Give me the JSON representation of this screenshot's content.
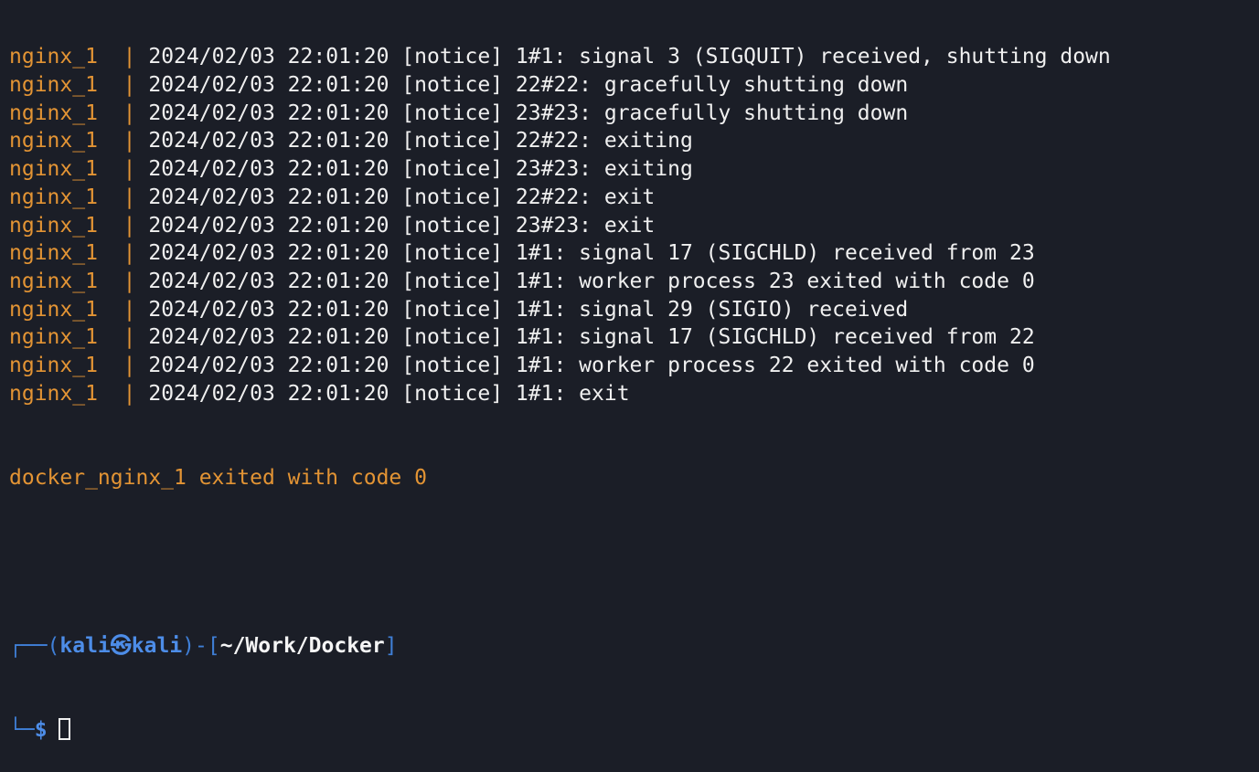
{
  "log": {
    "lines": [
      {
        "service": "nginx_1",
        "separator": "|",
        "message": "2024/02/03 22:01:20 [notice] 1#1: signal 3 (SIGQUIT) received, shutting down"
      },
      {
        "service": "nginx_1",
        "separator": "|",
        "message": "2024/02/03 22:01:20 [notice] 22#22: gracefully shutting down"
      },
      {
        "service": "nginx_1",
        "separator": "|",
        "message": "2024/02/03 22:01:20 [notice] 23#23: gracefully shutting down"
      },
      {
        "service": "nginx_1",
        "separator": "|",
        "message": "2024/02/03 22:01:20 [notice] 22#22: exiting"
      },
      {
        "service": "nginx_1",
        "separator": "|",
        "message": "2024/02/03 22:01:20 [notice] 23#23: exiting"
      },
      {
        "service": "nginx_1",
        "separator": "|",
        "message": "2024/02/03 22:01:20 [notice] 22#22: exit"
      },
      {
        "service": "nginx_1",
        "separator": "|",
        "message": "2024/02/03 22:01:20 [notice] 23#23: exit"
      },
      {
        "service": "nginx_1",
        "separator": "|",
        "message": "2024/02/03 22:01:20 [notice] 1#1: signal 17 (SIGCHLD) received from 23"
      },
      {
        "service": "nginx_1",
        "separator": "|",
        "message": "2024/02/03 22:01:20 [notice] 1#1: worker process 23 exited with code 0"
      },
      {
        "service": "nginx_1",
        "separator": "|",
        "message": "2024/02/03 22:01:20 [notice] 1#1: signal 29 (SIGIO) received"
      },
      {
        "service": "nginx_1",
        "separator": "|",
        "message": "2024/02/03 22:01:20 [notice] 1#1: signal 17 (SIGCHLD) received from 22"
      },
      {
        "service": "nginx_1",
        "separator": "|",
        "message": "2024/02/03 22:01:20 [notice] 1#1: worker process 22 exited with code 0"
      },
      {
        "service": "nginx_1",
        "separator": "|",
        "message": "2024/02/03 22:01:20 [notice] 1#1: exit"
      }
    ],
    "exit_message": "docker_nginx_1 exited with code 0"
  },
  "prompt": {
    "top_prefix": "┌──(",
    "user": "kali",
    "at_symbol": "㉿",
    "host": "kali",
    "mid": ")-[",
    "path": "~/Work/Docker",
    "close": "]",
    "bottom_prefix": "└─",
    "dollar": "$"
  },
  "colors": {
    "background": "#1b1e27",
    "service": "#e39434",
    "text": "#f0f0f0",
    "prompt_blue": "#4d8de8"
  }
}
